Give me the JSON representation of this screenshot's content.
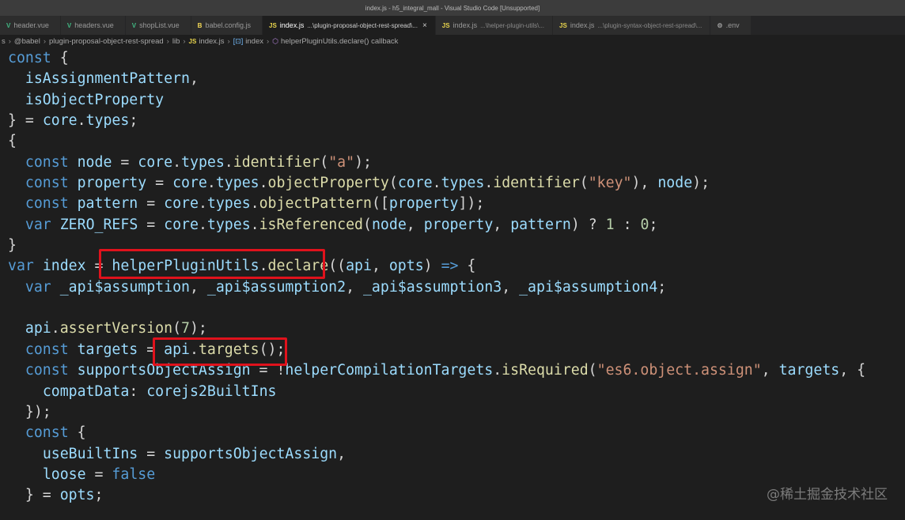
{
  "window": {
    "title": "index.js - h5_integral_mall - Visual Studio Code [Unsupported]"
  },
  "tabs": [
    {
      "icon": "vue",
      "name": "header.vue",
      "desc": "",
      "active": false
    },
    {
      "icon": "vue",
      "name": "headers.vue",
      "desc": "",
      "active": false
    },
    {
      "icon": "vue",
      "name": "shopList.vue",
      "desc": "",
      "active": false
    },
    {
      "icon": "babel",
      "name": "babel.config.js",
      "desc": "",
      "active": false
    },
    {
      "icon": "js",
      "name": "index.js",
      "desc": "...\\plugin-proposal-object-rest-spread\\...",
      "active": true
    },
    {
      "icon": "js",
      "name": "index.js",
      "desc": "...\\helper-plugin-utils\\...",
      "active": false
    },
    {
      "icon": "js",
      "name": "index.js",
      "desc": "...\\plugin-syntax-object-rest-spread\\...",
      "active": false
    },
    {
      "icon": "gear",
      "name": ".env",
      "desc": "",
      "active": false
    }
  ],
  "icon_labels": {
    "js": "JS",
    "vue": "V",
    "babel": "B",
    "gear": "⚙",
    "close": "×"
  },
  "breadcrumb": [
    "s",
    "@babel",
    "plugin-proposal-object-rest-spread",
    "lib",
    "index.js",
    "index",
    "helperPluginUtils.declare() callback"
  ],
  "code_lines": [
    [
      [
        "kw",
        "const"
      ],
      [
        "pl",
        " {"
      ]
    ],
    [
      [
        "pl",
        "  "
      ],
      [
        "vr",
        "isAssignmentPattern"
      ],
      [
        "pl",
        ","
      ]
    ],
    [
      [
        "pl",
        "  "
      ],
      [
        "vr",
        "isObjectProperty"
      ]
    ],
    [
      [
        "pl",
        "} = "
      ],
      [
        "vr",
        "core"
      ],
      [
        "pl",
        "."
      ],
      [
        "vr",
        "types"
      ],
      [
        "pl",
        ";"
      ]
    ],
    [
      [
        "pl",
        "{"
      ]
    ],
    [
      [
        "pl",
        "  "
      ],
      [
        "kw",
        "const"
      ],
      [
        "pl",
        " "
      ],
      [
        "vr",
        "node"
      ],
      [
        "pl",
        " = "
      ],
      [
        "vr",
        "core"
      ],
      [
        "pl",
        "."
      ],
      [
        "vr",
        "types"
      ],
      [
        "pl",
        "."
      ],
      [
        "fn",
        "identifier"
      ],
      [
        "pl",
        "("
      ],
      [
        "st",
        "\"a\""
      ],
      [
        "pl",
        ");"
      ]
    ],
    [
      [
        "pl",
        "  "
      ],
      [
        "kw",
        "const"
      ],
      [
        "pl",
        " "
      ],
      [
        "vr",
        "property"
      ],
      [
        "pl",
        " = "
      ],
      [
        "vr",
        "core"
      ],
      [
        "pl",
        "."
      ],
      [
        "vr",
        "types"
      ],
      [
        "pl",
        "."
      ],
      [
        "fn",
        "objectProperty"
      ],
      [
        "pl",
        "("
      ],
      [
        "vr",
        "core"
      ],
      [
        "pl",
        "."
      ],
      [
        "vr",
        "types"
      ],
      [
        "pl",
        "."
      ],
      [
        "fn",
        "identifier"
      ],
      [
        "pl",
        "("
      ],
      [
        "st",
        "\"key\""
      ],
      [
        "pl",
        "), "
      ],
      [
        "vr",
        "node"
      ],
      [
        "pl",
        ");"
      ]
    ],
    [
      [
        "pl",
        "  "
      ],
      [
        "kw",
        "const"
      ],
      [
        "pl",
        " "
      ],
      [
        "vr",
        "pattern"
      ],
      [
        "pl",
        " = "
      ],
      [
        "vr",
        "core"
      ],
      [
        "pl",
        "."
      ],
      [
        "vr",
        "types"
      ],
      [
        "pl",
        "."
      ],
      [
        "fn",
        "objectPattern"
      ],
      [
        "pl",
        "(["
      ],
      [
        "vr",
        "property"
      ],
      [
        "pl",
        "]);"
      ]
    ],
    [
      [
        "pl",
        "  "
      ],
      [
        "kw",
        "var"
      ],
      [
        "pl",
        " "
      ],
      [
        "vr",
        "ZERO_REFS"
      ],
      [
        "pl",
        " = "
      ],
      [
        "vr",
        "core"
      ],
      [
        "pl",
        "."
      ],
      [
        "vr",
        "types"
      ],
      [
        "pl",
        "."
      ],
      [
        "fn",
        "isReferenced"
      ],
      [
        "pl",
        "("
      ],
      [
        "vr",
        "node"
      ],
      [
        "pl",
        ", "
      ],
      [
        "vr",
        "property"
      ],
      [
        "pl",
        ", "
      ],
      [
        "vr",
        "pattern"
      ],
      [
        "pl",
        ") ? "
      ],
      [
        "nm",
        "1"
      ],
      [
        "pl",
        " : "
      ],
      [
        "nm",
        "0"
      ],
      [
        "pl",
        ";"
      ]
    ],
    [
      [
        "pl",
        "}"
      ]
    ],
    [
      [
        "kw",
        "var"
      ],
      [
        "pl",
        " "
      ],
      [
        "vr",
        "index"
      ],
      [
        "pl",
        " = "
      ],
      [
        "vr",
        "helperPluginUtils"
      ],
      [
        "pl",
        "."
      ],
      [
        "fn",
        "declare"
      ],
      [
        "pl",
        "(("
      ],
      [
        "vr",
        "api"
      ],
      [
        "pl",
        ", "
      ],
      [
        "vr",
        "opts"
      ],
      [
        "pl",
        ") "
      ],
      [
        "kw",
        "=>"
      ],
      [
        "pl",
        " {"
      ]
    ],
    [
      [
        "pl",
        "  "
      ],
      [
        "kw",
        "var"
      ],
      [
        "pl",
        " "
      ],
      [
        "vr",
        "_api$assumption"
      ],
      [
        "pl",
        ", "
      ],
      [
        "vr",
        "_api$assumption2"
      ],
      [
        "pl",
        ", "
      ],
      [
        "vr",
        "_api$assumption3"
      ],
      [
        "pl",
        ", "
      ],
      [
        "vr",
        "_api$assumption4"
      ],
      [
        "pl",
        ";"
      ]
    ],
    [
      [
        "pl",
        ""
      ]
    ],
    [
      [
        "pl",
        "  "
      ],
      [
        "vr",
        "api"
      ],
      [
        "pl",
        "."
      ],
      [
        "fn",
        "assertVersion"
      ],
      [
        "pl",
        "("
      ],
      [
        "nm",
        "7"
      ],
      [
        "pl",
        ");"
      ]
    ],
    [
      [
        "pl",
        "  "
      ],
      [
        "kw",
        "const"
      ],
      [
        "pl",
        " "
      ],
      [
        "vr",
        "targets"
      ],
      [
        "pl",
        " = "
      ],
      [
        "vr",
        "api"
      ],
      [
        "pl",
        "."
      ],
      [
        "fn",
        "targets"
      ],
      [
        "pl",
        "();"
      ]
    ],
    [
      [
        "pl",
        "  "
      ],
      [
        "kw",
        "const"
      ],
      [
        "pl",
        " "
      ],
      [
        "vr",
        "supportsObjectAssign"
      ],
      [
        "pl",
        " = !"
      ],
      [
        "vr",
        "helperCompilationTargets"
      ],
      [
        "pl",
        "."
      ],
      [
        "fn",
        "isRequired"
      ],
      [
        "pl",
        "("
      ],
      [
        "st",
        "\"es6.object.assign\""
      ],
      [
        "pl",
        ", "
      ],
      [
        "vr",
        "targets"
      ],
      [
        "pl",
        ", {"
      ]
    ],
    [
      [
        "pl",
        "    "
      ],
      [
        "vr",
        "compatData"
      ],
      [
        "pl",
        ": "
      ],
      [
        "vr",
        "corejs2BuiltIns"
      ]
    ],
    [
      [
        "pl",
        "  });"
      ]
    ],
    [
      [
        "pl",
        "  "
      ],
      [
        "kw",
        "const"
      ],
      [
        "pl",
        " {"
      ]
    ],
    [
      [
        "pl",
        "    "
      ],
      [
        "vr",
        "useBuiltIns"
      ],
      [
        "pl",
        " = "
      ],
      [
        "vr",
        "supportsObjectAssign"
      ],
      [
        "pl",
        ","
      ]
    ],
    [
      [
        "pl",
        "    "
      ],
      [
        "vr",
        "loose"
      ],
      [
        "pl",
        " = "
      ],
      [
        "kw",
        "false"
      ]
    ],
    [
      [
        "pl",
        "  } = "
      ],
      [
        "vr",
        "opts"
      ],
      [
        "pl",
        ";"
      ]
    ]
  ],
  "watermark": "@稀土掘金技术社区"
}
